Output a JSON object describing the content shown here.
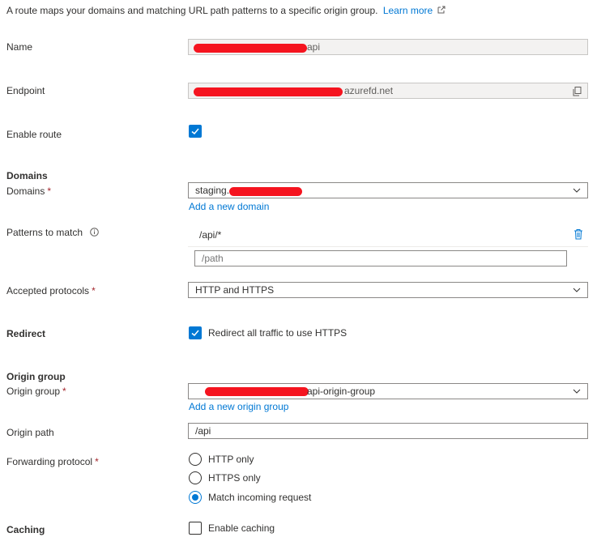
{
  "intro": {
    "text": "A route maps your domains and matching URL path patterns to a specific origin group.",
    "learn_more": "Learn more"
  },
  "name": {
    "label": "Name",
    "value_suffix": "api"
  },
  "endpoint": {
    "label": "Endpoint",
    "value_suffix": "azurefd.net"
  },
  "enable_route": {
    "label": "Enable route",
    "checked": true
  },
  "domains": {
    "section": "Domains",
    "label": "Domains",
    "required": "*",
    "value_prefix": "staging.",
    "add_link": "Add a new domain"
  },
  "patterns": {
    "label": "Patterns to match",
    "info_icon": "info-icon",
    "items": [
      "/api/*"
    ],
    "placeholder": "/path"
  },
  "protocols": {
    "label": "Accepted protocols",
    "required": "*",
    "value": "HTTP and HTTPS"
  },
  "redirect": {
    "section": "Redirect",
    "checkbox_label": "Redirect all traffic to use HTTPS",
    "checked": true
  },
  "origin_group": {
    "section": "Origin group",
    "label": "Origin group",
    "required": "*",
    "value_suffix": "api-origin-group",
    "add_link": "Add a new origin group"
  },
  "origin_path": {
    "label": "Origin path",
    "value": "/api"
  },
  "forwarding": {
    "label": "Forwarding protocol",
    "required": "*",
    "options": [
      "HTTP only",
      "HTTPS only",
      "Match incoming request"
    ],
    "selected": "Match incoming request"
  },
  "caching": {
    "section": "Caching",
    "checkbox_label": "Enable caching",
    "checked": false
  },
  "colors": {
    "accent": "#0078d4",
    "required": "#a4262c",
    "redaction": "#f5141f"
  }
}
